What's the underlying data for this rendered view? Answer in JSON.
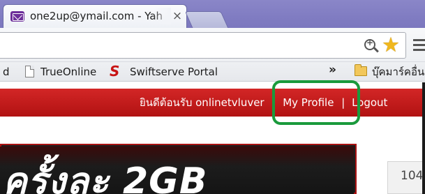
{
  "browser": {
    "tab": {
      "title": "one2up@ymail.com - Yah",
      "close": "×"
    }
  },
  "bookmarks": {
    "items": [
      {
        "label": "d"
      },
      {
        "label": "TrueOnline"
      },
      {
        "label": "Swiftserve Portal"
      }
    ],
    "overflow": "»",
    "folder": "บุ๊คมาร์คอื่น"
  },
  "page": {
    "nav": {
      "welcome": "ยินดีต้อนรับ onlinetvluver",
      "sep": "|",
      "profile": "My Profile",
      "logout": "Logout"
    },
    "banner": {
      "text": "ครั้งละ 2GB"
    },
    "side_value": "104",
    "highlight_color": "#1a9a3c",
    "nav_color": "#c21a1a"
  }
}
